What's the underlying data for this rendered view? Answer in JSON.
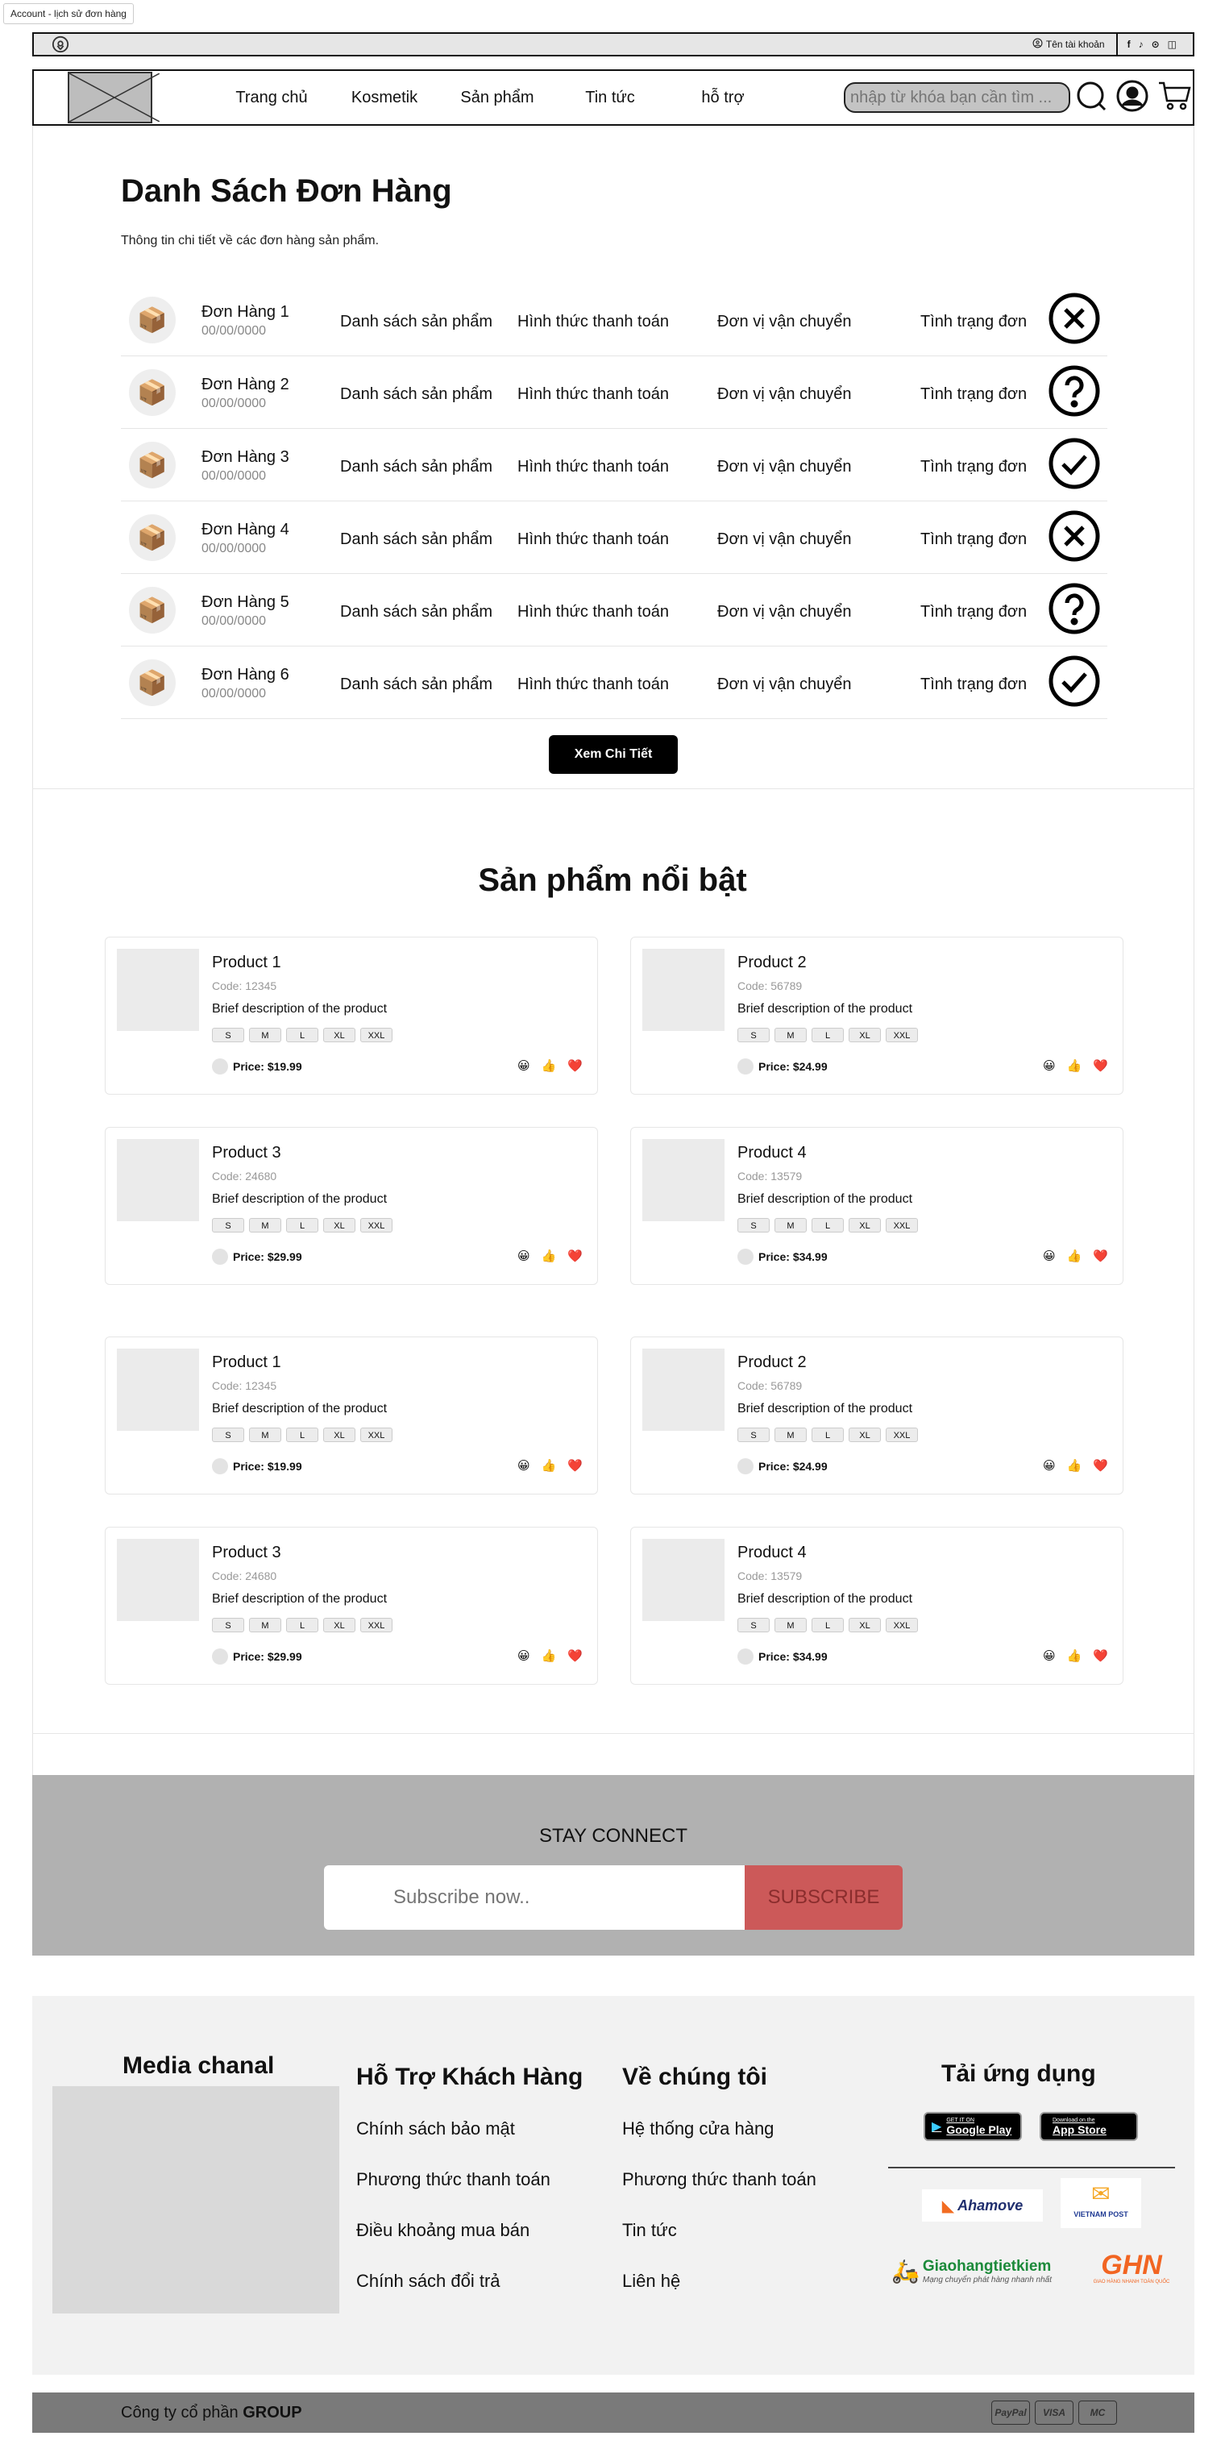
{
  "page_tab": "Account - lịch sử đơn hàng",
  "topbar": {
    "account_label": "Tên tài khoản",
    "icons": [
      "location-icon",
      "user-icon",
      "facebook-icon",
      "tiktok-icon",
      "youtube-icon",
      "instagram-icon"
    ]
  },
  "nav": {
    "links": [
      "Trang chủ",
      "Kosmetik",
      "Sản phẩm",
      "Tin tức",
      "hỗ trợ"
    ],
    "search_placeholder": "nhập từ khóa bạn cần tìm ..."
  },
  "orders": {
    "title": "Danh Sách Đơn Hàng",
    "subtitle": "Thông tin chi tiết về các đơn hàng sản phẩm.",
    "col_products": "Danh sách sản phẩm",
    "col_payment": "Hình thức thanh toán",
    "col_shipping": "Đơn vị vận chuyển",
    "col_status": "Tình trạng đơn",
    "rows": [
      {
        "name": "Đơn Hàng 1",
        "date": "00/00/0000",
        "status": "cancelled"
      },
      {
        "name": "Đơn Hàng 2",
        "date": "00/00/0000",
        "status": "pending"
      },
      {
        "name": "Đơn Hàng 3",
        "date": "00/00/0000",
        "status": "done"
      },
      {
        "name": "Đơn Hàng 4",
        "date": "00/00/0000",
        "status": "cancelled"
      },
      {
        "name": "Đơn Hàng 5",
        "date": "00/00/0000",
        "status": "pending"
      },
      {
        "name": "Đơn Hàng 6",
        "date": "00/00/0000",
        "status": "done"
      }
    ],
    "details_button": "Xem Chi Tiết"
  },
  "featured": {
    "title": "Sản phẩm nổi bật",
    "sizes": [
      "S",
      "M",
      "L",
      "XL",
      "XXL"
    ],
    "price_prefix": "Price: ",
    "products": [
      {
        "name": "Product 1",
        "code": "Code: 12345",
        "desc": "Brief description of the product",
        "price": "$19.99"
      },
      {
        "name": "Product 2",
        "code": "Code: 56789",
        "desc": "Brief description of the product",
        "price": "$24.99"
      },
      {
        "name": "Product 3",
        "code": "Code: 24680",
        "desc": "Brief description of the product",
        "price": "$29.99"
      },
      {
        "name": "Product 4",
        "code": "Code: 13579",
        "desc": "Brief description of the product",
        "price": "$34.99"
      },
      {
        "name": "Product 1",
        "code": "Code: 12345",
        "desc": "Brief description of the product",
        "price": "$19.99"
      },
      {
        "name": "Product 2",
        "code": "Code: 56789",
        "desc": "Brief description of the product",
        "price": "$24.99"
      },
      {
        "name": "Product 3",
        "code": "Code: 24680",
        "desc": "Brief description of the product",
        "price": "$29.99"
      },
      {
        "name": "Product 4",
        "code": "Code: 13579",
        "desc": "Brief description of the product",
        "price": "$34.99"
      }
    ],
    "reactions": [
      "😀",
      "👍",
      "❤️"
    ]
  },
  "newsletter": {
    "title": "STAY CONNECT",
    "placeholder": "Subscribe now..",
    "button": "SUBSCRIBE"
  },
  "footer": {
    "media_title": "Media chanal",
    "support": {
      "title": "Hỗ Trợ Khách Hàng",
      "links": [
        "Chính sách bảo mật",
        "Phương thức thanh toán",
        "Điều khoảng mua bán",
        "Chính sách đổi trả"
      ]
    },
    "about": {
      "title": "Về chúng tôi",
      "links": [
        "Hệ thống cửa hàng",
        "Phương thức thanh toán",
        "Tin tức",
        "Liên hệ"
      ]
    },
    "app": {
      "title": "Tải ứng dụng",
      "google_small": "GET IT ON",
      "google_large": "Google Play",
      "apple_small": "Download on the",
      "apple_large": "App Store"
    },
    "partners": {
      "ahamove": "Ahamove",
      "vnpost": "VIETNAM POST",
      "ghtk": "Giaohangtietkiem",
      "ghtk_tag": "Mạng chuyển phát hàng nhanh nhất",
      "ghn": "GHN",
      "ghn_tag": "GIAO HÀNG NHANH TOÀN QUỐC"
    }
  },
  "bottom": {
    "company_prefix": "Công ty cổ phần ",
    "company_name": "GROUP",
    "payments": [
      "PayPal",
      "VISA",
      "MC"
    ]
  },
  "colors": {
    "topbar_bg": "#e6e6e6",
    "newsletter_bg": "#b1b1b1",
    "subscribe_bg": "#cc5959",
    "footer_bg": "#f2f2f2",
    "bottom_bar_bg": "#7a7a7a"
  }
}
